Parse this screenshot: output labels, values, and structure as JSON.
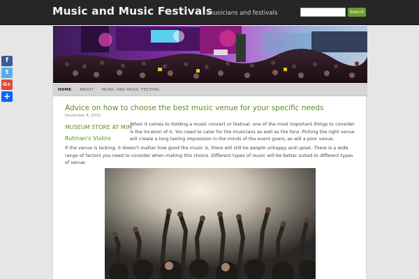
{
  "header": {
    "title": "Music and Music Festivals",
    "tagline": "musicians and festivals",
    "search_placeholder": "",
    "search_button": "Search"
  },
  "nav": {
    "items": [
      {
        "label": "HOME"
      },
      {
        "label": "ABOUT"
      },
      {
        "label": "MUSIC AND MUSIC FESTIVAL"
      }
    ]
  },
  "post": {
    "title": "Advice on how to choose the best music venue for your specific needs",
    "date": "December 4, 2015",
    "paragraphs": [
      "When it comes to holding a music concert or festival, one of the most important things to consider is the location of it. You need to cater for the musicians as well as the fans. Picking the right venue will create a long lasting impression in the minds of the event goers, as will a poor venue.",
      "If the venue is lacking, it doesn't matter how good the music is, there will still be people unhappy and upset. There is a wide range of factors you need to consider when making this choice. Different types of music will be better suited to different types of venue."
    ]
  },
  "sidebar": {
    "links": [
      {
        "label": "MUSEUM STORE AT MIM"
      },
      {
        "label": "Rutman's Violins"
      }
    ]
  },
  "share": {
    "buttons": [
      {
        "icon": "facebook-icon",
        "glyph": "f",
        "color": "#3b5998"
      },
      {
        "icon": "twitter-icon",
        "glyph": "t",
        "color": "#55acee"
      },
      {
        "icon": "google-plus-icon",
        "glyph": "G+",
        "color": "#dd4b39"
      },
      {
        "icon": "share-plus-icon",
        "glyph": "+",
        "color": "#0166ff"
      }
    ]
  },
  "colors": {
    "header_bg": "#262626",
    "accent_green": "#5d8c1f",
    "nav_bg": "#d5d5d5"
  }
}
